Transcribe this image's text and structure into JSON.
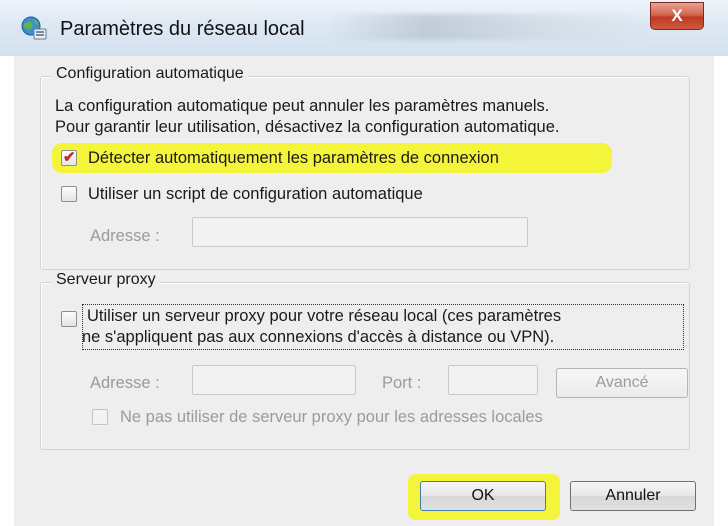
{
  "window": {
    "title": "Paramètres du réseau local",
    "close_label": "X"
  },
  "auto_config": {
    "group_title": "Configuration automatique",
    "description_line1": "La configuration automatique peut annuler les paramètres manuels.",
    "description_line2": "Pour garantir leur utilisation, désactivez la configuration automatique.",
    "detect_checkbox": {
      "label": "Détecter automatiquement les paramètres de connexion",
      "checked": true
    },
    "script_checkbox": {
      "label": "Utiliser un script de configuration automatique",
      "checked": false
    },
    "address_label": "Adresse :",
    "address_value": ""
  },
  "proxy": {
    "group_title": "Serveur proxy",
    "use_proxy_line1": "Utiliser un serveur proxy pour votre réseau local (ces paramètres",
    "use_proxy_line2": "ne s'appliquent pas aux connexions d'accès à distance ou VPN).",
    "use_proxy_checked": false,
    "address_label": "Adresse :",
    "address_value": "",
    "port_label": "Port :",
    "port_value": "",
    "advanced_label": "Avancé",
    "bypass_label": "Ne pas utiliser de serveur proxy pour les adresses locales",
    "bypass_checked": false
  },
  "buttons": {
    "ok": "OK",
    "cancel": "Annuler"
  },
  "colors": {
    "highlight": "#f4f43a",
    "close_button": "#c9452c",
    "check_mark": "#c0282e"
  }
}
